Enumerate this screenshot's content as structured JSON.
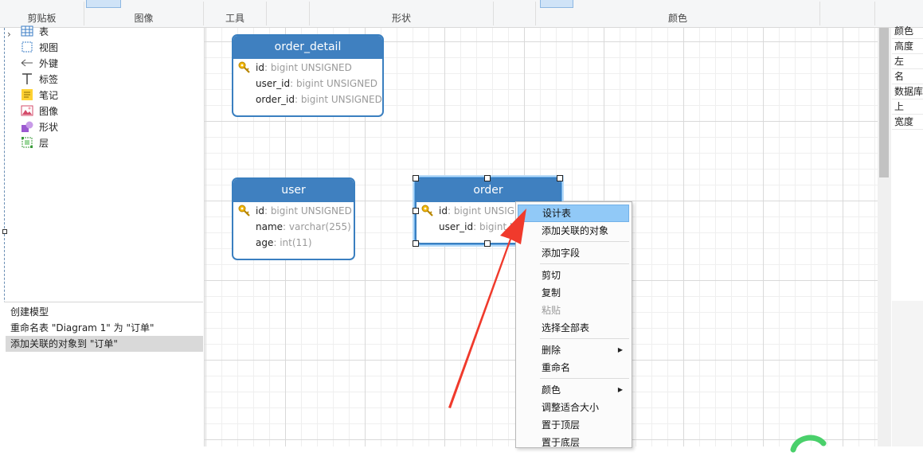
{
  "ribbon": {
    "groups": [
      "剪贴板",
      "图像",
      "工具",
      "形状",
      "颜色"
    ]
  },
  "tree": {
    "items": [
      {
        "label": "表",
        "icon": "table-icon"
      },
      {
        "label": "视图",
        "icon": "view-icon"
      },
      {
        "label": "外键",
        "icon": "foreign-key-icon"
      },
      {
        "label": "标签",
        "icon": "label-icon"
      },
      {
        "label": "笔记",
        "icon": "note-icon"
      },
      {
        "label": "图像",
        "icon": "image-icon"
      },
      {
        "label": "形状",
        "icon": "shape-icon"
      },
      {
        "label": "层",
        "icon": "layer-icon"
      }
    ]
  },
  "history": {
    "items": [
      "创建模型",
      "重命名表 \"Diagram 1\" 为 \"订单\"",
      "添加关联的对象到 \"订单\""
    ]
  },
  "properties": {
    "rows": [
      "颜色",
      "高度",
      "左",
      "名",
      "数据库",
      "上",
      "宽度"
    ]
  },
  "tables": {
    "order_detail": {
      "title": "order_detail",
      "columns": [
        {
          "name": "id",
          "sep": ": ",
          "type": "bigint UNSIGNED"
        },
        {
          "name": "user_id",
          "sep": ": ",
          "type": "bigint UNSIGNED"
        },
        {
          "name": "order_id",
          "sep": ": ",
          "type": "bigint UNSIGNED"
        }
      ]
    },
    "user": {
      "title": "user",
      "columns": [
        {
          "name": "id",
          "sep": ": ",
          "type": "bigint UNSIGNED"
        },
        {
          "name": "name",
          "sep": ": ",
          "type": "varchar(255)"
        },
        {
          "name": "age",
          "sep": ": ",
          "type": "int(11)"
        }
      ]
    },
    "order": {
      "title": "order",
      "columns": [
        {
          "name": "id",
          "sep": ": ",
          "type": "bigint UNSIGNED"
        },
        {
          "name": "user_id",
          "sep": ": ",
          "type": "bigint UNSIGNED"
        }
      ]
    }
  },
  "context_menu": {
    "items": [
      "设计表",
      "添加关联的对象",
      "添加字段",
      "剪切",
      "复制",
      "粘贴",
      "选择全部表",
      "删除",
      "重命名",
      "颜色",
      "调整适合大小",
      "置于顶层",
      "置于底层"
    ]
  },
  "colors": {
    "table_header": "#3f80c0",
    "menu_highlight": "#91c9f7",
    "arrow": "#f03a2c"
  }
}
